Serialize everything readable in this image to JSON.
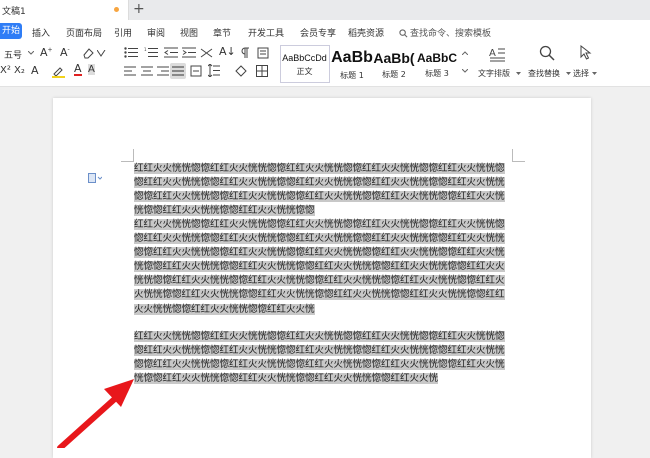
{
  "tab": {
    "title": "文稿1"
  },
  "menu": {
    "start": "开始",
    "items": [
      "插入",
      "页面布局",
      "引用",
      "审阅",
      "视图",
      "章节",
      "开发工具",
      "会员专享",
      "稻壳资源"
    ],
    "search_placeholder": "查找命令、搜索模板"
  },
  "ribbon": {
    "font_size": "五号",
    "styles": [
      {
        "sample": "AaBbCcDd",
        "name": "正文"
      },
      {
        "sample": "AaBb",
        "name": "标题 1"
      },
      {
        "sample": "AaBb(",
        "name": "标题 2"
      },
      {
        "sample": "AaBbC",
        "name": "标题 3"
      }
    ],
    "text_layout": "文字排版",
    "find_replace": "查找替换",
    "select": "选择"
  },
  "document": {
    "paragraphs": [
      "红红火火恍恍惚惚红红火火恍恍惚惚红红火火恍恍惚惚红红火火恍恍惚惚红红火火恍恍惚惚红红火火恍恍惚惚红红火火恍恍惚惚红红火火恍恍惚惚红红火火恍恍惚惚红红火火恍恍惚惚红红火火恍恍惚惚红红火火恍恍惚惚红红火火恍恍惚惚红红火火恍恍惚惚红红火火恍恍惚惚红红火火恍恍惚惚红红火火恍恍惚惚",
      "红红火火恍恍惚惚红红火火恍恍惚惚红红火火恍恍惚惚红红火火恍恍惚惚红红火火恍恍惚惚红红火火恍恍惚惚红红火火恍恍惚惚红红火火恍恍惚惚红红火火恍恍惚惚红红火火恍恍惚惚红红火火恍恍惚惚红红火火恍恍惚惚红红火火恍恍惚惚红红火火恍恍惚惚红红火火恍恍惚惚红红火火恍恍惚惚红红火火恍恍惚惚红红火火恍恍惚惚红红火火恍恍惚惚红红火火恍恍惚惚红红火火恍恍惚惚红红火火恍恍惚惚红红火火恍恍惚惚红红火火恍恍惚惚红红火火恍恍惚惚红红火火恍恍惚惚红红火火恍恍惚惚红红火火恍恍惚惚红红火火恍恍惚惚红红火火恍恍惚惚红红火火恍恍惚惚红红火火恍",
      "红红火火恍恍惚惚红红火火恍恍惚惚红红火火恍恍惚惚红红火火恍恍惚惚红红火火恍恍惚惚红红火火恍恍惚惚红红火火恍恍惚惚红红火火恍恍惚惚红红火火恍恍惚惚红红火火恍恍惚惚红红火火恍恍惚惚红红火火恍恍惚惚红红火火恍恍惚惚红红火火恍恍惚惚红红火火恍恍惚惚红红火火恍恍惚惚红红火火恍恍惚惚红红火火恍恍惚惚红红火火恍"
    ]
  },
  "colors": {
    "accent": "#2f7df6",
    "selection": "#c8c8c8",
    "arrow": "#e8171b"
  }
}
